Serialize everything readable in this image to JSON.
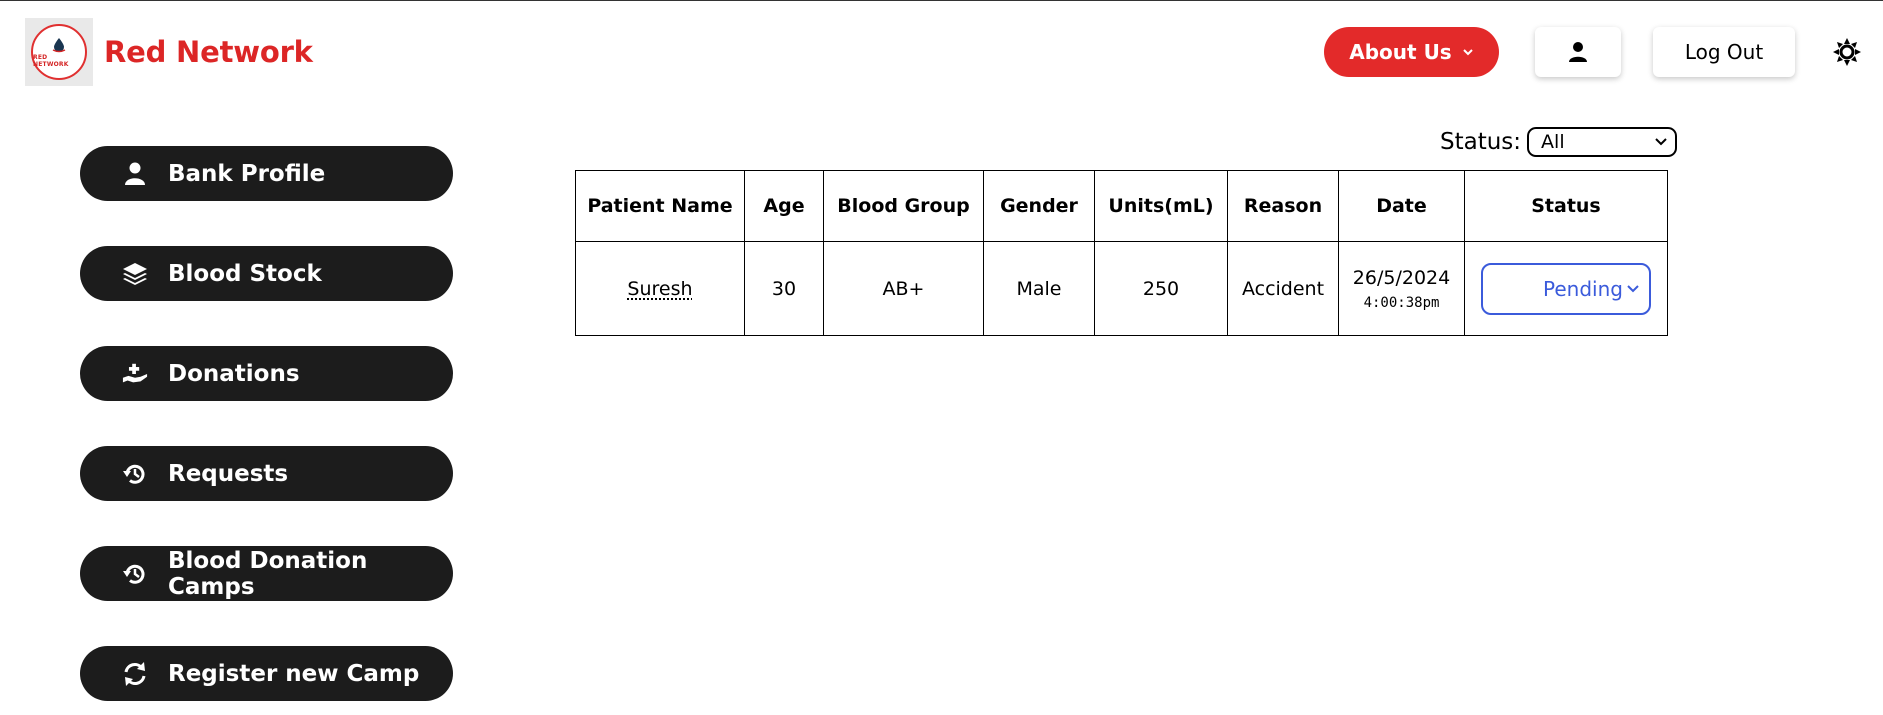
{
  "brand": {
    "logo_text": "RED NETWORK",
    "name": "Red Network",
    "accent_color": "#dc2626"
  },
  "header": {
    "about_label": "About Us",
    "about_icon": "chevron-down-icon",
    "user_icon": "user-icon",
    "logout_label": "Log Out",
    "theme_icon": "sun-icon"
  },
  "sidebar": {
    "items": [
      {
        "label": "Bank Profile",
        "icon": "user-icon"
      },
      {
        "label": "Blood Stock",
        "icon": "layers-icon"
      },
      {
        "label": "Donations",
        "icon": "hand-donate-icon"
      },
      {
        "label": "Requests",
        "icon": "history-icon"
      },
      {
        "label": "Blood Donation Camps",
        "icon": "history-icon"
      },
      {
        "label": "Register new Camp",
        "icon": "refresh-icon"
      }
    ]
  },
  "filter": {
    "label": "Status:",
    "selected": "All"
  },
  "table": {
    "headers": [
      "Patient Name",
      "Age",
      "Blood Group",
      "Gender",
      "Units(mL)",
      "Reason",
      "Date",
      "Status"
    ],
    "rows": [
      {
        "patient_name": "Suresh",
        "age": "30",
        "blood_group": "AB+",
        "gender": "Male",
        "units": "250",
        "reason": "Accident",
        "date": "26/5/2024",
        "time": "4:00:38pm",
        "status": "Pending"
      }
    ]
  },
  "colors": {
    "primary_red": "#e32a2a",
    "sidebar_bg": "#1c1c1c",
    "status_blue": "#3b5bdb"
  }
}
